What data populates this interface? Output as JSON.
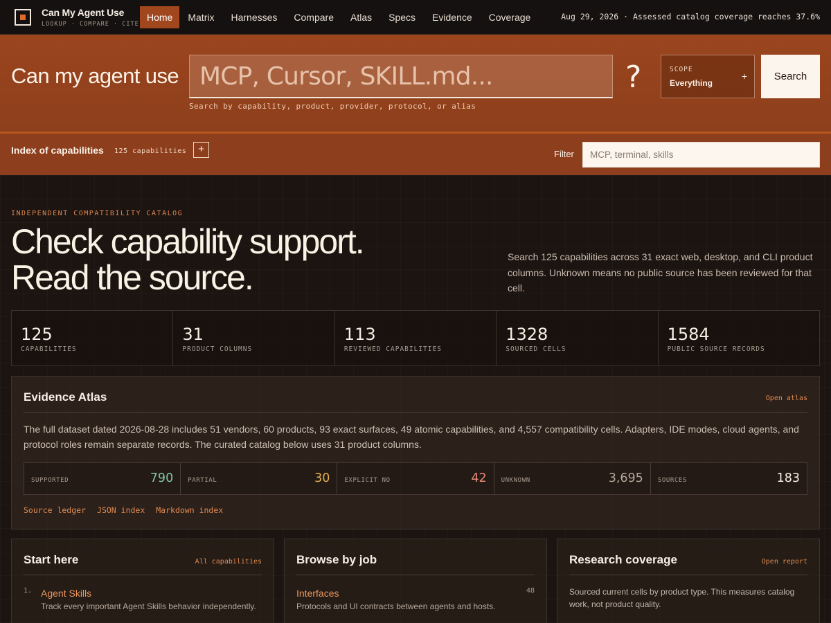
{
  "brand": {
    "title": "Can My Agent Use",
    "subtitle": "LOOKUP · COMPARE · CITE"
  },
  "nav": {
    "items": [
      "Home",
      "Matrix",
      "Harnesses",
      "Compare",
      "Atlas",
      "Specs",
      "Evidence",
      "Coverage"
    ],
    "active": "Home",
    "status": "Aug 29, 2026 · Assessed catalog coverage reaches 37.6%"
  },
  "search": {
    "lead": "Can my agent use",
    "placeholder": "MCP, Cursor, SKILL.md...",
    "help": "Search by capability, product, provider, protocol, or alias",
    "question": "?",
    "scope_label": "SCOPE",
    "scope_value": "Everything",
    "scope_plus": "+",
    "button": "Search"
  },
  "index": {
    "title": "Index of capabilities",
    "count": "125 capabilities",
    "plus": "+",
    "filter_label": "Filter",
    "filter_placeholder": "MCP, terminal, skills"
  },
  "hero": {
    "kicker": "INDEPENDENT COMPATIBILITY CATALOG",
    "title_line1": "Check capability support.",
    "title_line2": "Read the source.",
    "description": "Search 125 capabilities across 31 exact web, desktop, and CLI product columns. Unknown means no public source has been reviewed for that cell."
  },
  "stats": [
    {
      "num": "125",
      "label": "CAPABILITIES"
    },
    {
      "num": "31",
      "label": "PRODUCT COLUMNS"
    },
    {
      "num": "113",
      "label": "REVIEWED CAPABILITIES"
    },
    {
      "num": "1328",
      "label": "SOURCED CELLS"
    },
    {
      "num": "1584",
      "label": "PUBLIC SOURCE RECORDS"
    }
  ],
  "atlas": {
    "title": "Evidence Atlas",
    "link": "Open atlas",
    "description": "The full dataset dated 2026-08-28 includes 51 vendors, 60 products, 93 exact surfaces, 49 atomic capabilities, and 4,557 compatibility cells. Adapters, IDE modes, cloud agents, and protocol roles remain separate records. The curated catalog below uses 31 product columns.",
    "metrics": [
      {
        "label": "SUPPORTED",
        "value": "790",
        "color": "#7fc8a4"
      },
      {
        "label": "PARTIAL",
        "value": "30",
        "color": "#e1b04f"
      },
      {
        "label": "EXPLICIT NO",
        "value": "42",
        "color": "#e58a7a"
      },
      {
        "label": "UNKNOWN",
        "value": "3,695",
        "color": "#b4a79b"
      },
      {
        "label": "SOURCES",
        "value": "183",
        "color": "#f7eee4"
      }
    ],
    "links": [
      "Source ledger",
      "JSON index",
      "Markdown index"
    ]
  },
  "cards": {
    "start": {
      "title": "Start here",
      "link": "All capabilities",
      "item_num": "1.",
      "item_title": "Agent Skills",
      "item_desc": "Track every important Agent Skills behavior independently."
    },
    "browse": {
      "title": "Browse by job",
      "item_title": "Interfaces",
      "item_desc": "Protocols and UI contracts between agents and hosts.",
      "item_count": "48"
    },
    "coverage": {
      "title": "Research coverage",
      "link": "Open report",
      "description": "Sourced current cells by product type. This measures catalog work, not product quality."
    }
  }
}
